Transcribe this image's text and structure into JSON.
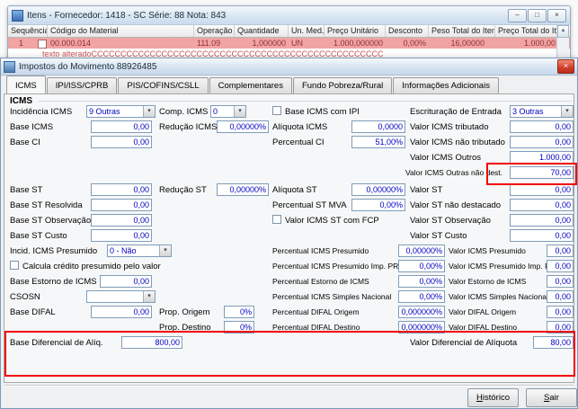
{
  "icons": {
    "close": "×",
    "minimize": "–",
    "maximize": "□",
    "scroll_up": "▲",
    "dropdown": "▾"
  },
  "win": {
    "title": "Itens - Fornecedor: 1418 - SC Série: 88   Nota: 843",
    "cols": [
      "Sequência",
      "Código do Material",
      "Operação",
      "Quantidade",
      "Un. Med.",
      "Preço Unitário",
      "Desconto",
      "Peso Total do Item",
      "Preço Total do Item"
    ],
    "row": {
      "sequencia": "1",
      "codigo": "00.000.014",
      "operacao": "111.09",
      "quantidade": "1,000000",
      "un_med": "UN",
      "preco_unitario": "1.000,000000",
      "desconto": "0,00%",
      "peso_total": "16,00000",
      "preco_total": "1.000,00",
      "descricao": "texto alteradoCCCCCCCCCCCCCCCCCCCCCCCCCCCCCCCCCCCCCCCCCCCCCCCCCC"
    }
  },
  "dlg": {
    "title": "Impostos do Movimento 88926485",
    "tabs": [
      "ICMS",
      "IPI/ISS/CPRB",
      "PIS/COFINS/CSLL",
      "Complementares",
      "Fundo Pobreza/Rural",
      "Informações Adicionais"
    ],
    "group": "ICMS",
    "buttons": {
      "historico": "Histórico",
      "sair": "Sair"
    }
  },
  "f": {
    "incidencia_icms": {
      "label": "Incidência ICMS",
      "value": "9 Outras"
    },
    "comp_icms": {
      "label": "Comp. ICMS",
      "value": "0"
    },
    "base_icms_com_ipi": {
      "label": "Base ICMS com IPI"
    },
    "escrituracao_entrada": {
      "label": "Escrituração de Entrada",
      "value": "3 Outras"
    },
    "base_icms": {
      "label": "Base ICMS",
      "value": "0,00"
    },
    "reducao_icms": {
      "label": "Redução ICMS",
      "value": "0,00000%"
    },
    "aliquota_icms": {
      "label": "Alíquota ICMS",
      "value": "0,0000"
    },
    "valor_icms_tributado": {
      "label": "Valor ICMS tributado",
      "value": "0,00"
    },
    "base_ci": {
      "label": "Base CI",
      "value": "0,00"
    },
    "percentual_ci": {
      "label": "Percentual CI",
      "value": "51,00%"
    },
    "valor_icms_nao_tributado": {
      "label": "Valor ICMS não tributado",
      "value": "0,00"
    },
    "valor_icms_outros": {
      "label": "Valor ICMS Outros",
      "value": "1.000,00"
    },
    "valor_icms_outras_nao_dest": {
      "label": "Valor ICMS Outras não dest.",
      "value": "70,00"
    },
    "base_st": {
      "label": "Base ST",
      "value": "0,00"
    },
    "reducao_st": {
      "label": "Redução ST",
      "value": "0,00000%"
    },
    "aliquota_st": {
      "label": "Alíquota ST",
      "value": "0,00000%"
    },
    "valor_st": {
      "label": "Valor ST",
      "value": "0,00"
    },
    "base_st_resolvida": {
      "label": "Base ST Resolvida",
      "value": "0,00"
    },
    "percentual_st_mva": {
      "label": "Percentual ST MVA",
      "value": "0,00%"
    },
    "valor_st_nao_destacado": {
      "label": "Valor ST não destacado",
      "value": "0,00"
    },
    "base_st_observacao": {
      "label": "Base ST Observação",
      "value": "0,00"
    },
    "valor_icms_st_com_fcp": {
      "label": "Valor ICMS ST com FCP"
    },
    "valor_st_observacao": {
      "label": "Valor ST Observação",
      "value": "0,00"
    },
    "base_st_custo": {
      "label": "Base ST Custo",
      "value": "0,00"
    },
    "valor_st_custo": {
      "label": "Valor ST Custo",
      "value": "0,00"
    },
    "incid_icms_presumido": {
      "label": "Incid. ICMS Presumido",
      "value": "0 - Não"
    },
    "percentual_icms_presumido": {
      "label": "Percentual ICMS Presumido",
      "value": "0,00000%"
    },
    "valor_icms_presumido": {
      "label": "Valor ICMS Presumido",
      "value": "0,00"
    },
    "calcula_credito": {
      "label": "Calcula crédito presumido pelo valor"
    },
    "percentual_icms_presumido_imp_pr": {
      "label": "Percentual ICMS Presumido Imp. PR",
      "value": "0,00%"
    },
    "valor_icms_presumido_imp_pr": {
      "label": "Valor ICMS Presumido Imp. PR",
      "value": "0,00"
    },
    "base_estorno_icms": {
      "label": "Base Estorno de ICMS",
      "value": "0,00"
    },
    "percentual_estorno_icms": {
      "label": "Percentual Estorno de ICMS",
      "value": "0,00%"
    },
    "valor_estorno_icms": {
      "label": "Valor Estorno de ICMS",
      "value": "0,00"
    },
    "csosn": {
      "label": "CSOSN",
      "value": ""
    },
    "percentual_icms_simples": {
      "label": "Percentual ICMS Simples Nacional",
      "value": "0,00%"
    },
    "valor_icms_simples": {
      "label": "Valor ICMS Simples Nacional",
      "value": "0,00"
    },
    "base_difal": {
      "label": "Base DIFAL",
      "value": "0,00"
    },
    "prop_origem": {
      "label": "Prop. Origem",
      "value": "0%"
    },
    "percentual_difal_origem": {
      "label": "Percentual DIFAL Origem",
      "value": "0,000000%"
    },
    "valor_difal_origem": {
      "label": "Valor DIFAL Origem",
      "value": "0,00"
    },
    "prop_destino": {
      "label": "Prop. Destino",
      "value": "0%"
    },
    "percentual_difal_destino": {
      "label": "Percentual DIFAL Destino",
      "value": "0,000000%"
    },
    "valor_difal_destino": {
      "label": "Valor DIFAL Destino",
      "value": "0,00"
    },
    "base_diferencial_aliq": {
      "label": "Base Diferencial de Alíq.",
      "value": "800,00"
    },
    "valor_diferencial_aliquota": {
      "label": "Valor Diferencial de Alíquota",
      "value": "80,00"
    }
  }
}
